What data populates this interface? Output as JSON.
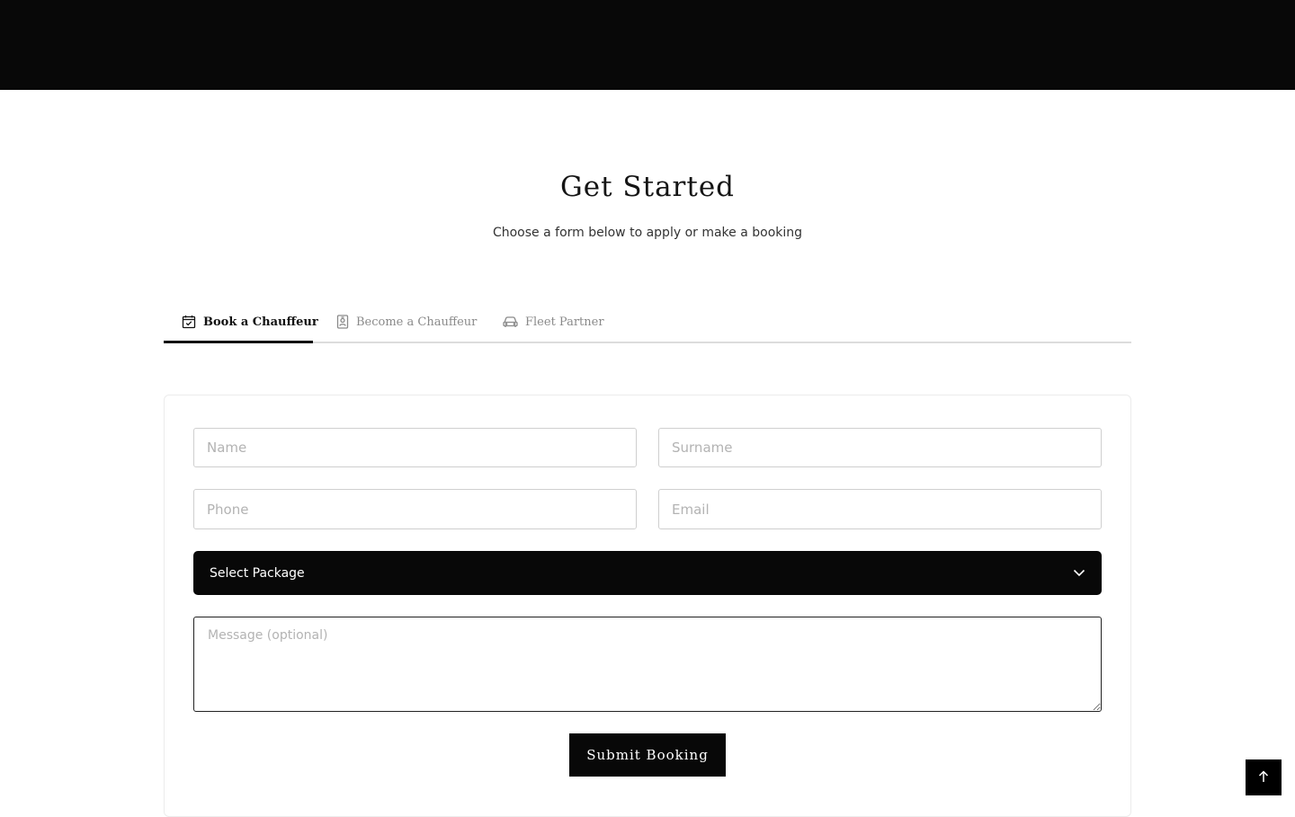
{
  "header": {
    "title": "Get Started",
    "subtitle": "Choose a form below to apply or make a booking"
  },
  "tabs": [
    {
      "label": "Book a Chauffeur",
      "icon": "calendar-check-icon",
      "active": true
    },
    {
      "label": "Become a Chauffeur",
      "icon": "id-badge-icon",
      "active": false
    },
    {
      "label": "Fleet Partner",
      "icon": "car-icon",
      "active": false
    }
  ],
  "form": {
    "name_placeholder": "Name",
    "surname_placeholder": "Surname",
    "phone_placeholder": "Phone",
    "email_placeholder": "Email",
    "package_select": {
      "selected": "Select Package",
      "icon": "chevron-down-icon"
    },
    "message_placeholder": "Message (optional)",
    "submit_label": "Submit Booking"
  },
  "scroll_to_top": {
    "icon": "arrow-up-icon"
  },
  "colors": {
    "primary": "#080808",
    "background": "#ffffff",
    "border": "#cfcfcf",
    "muted_text": "#8a8a8a"
  }
}
